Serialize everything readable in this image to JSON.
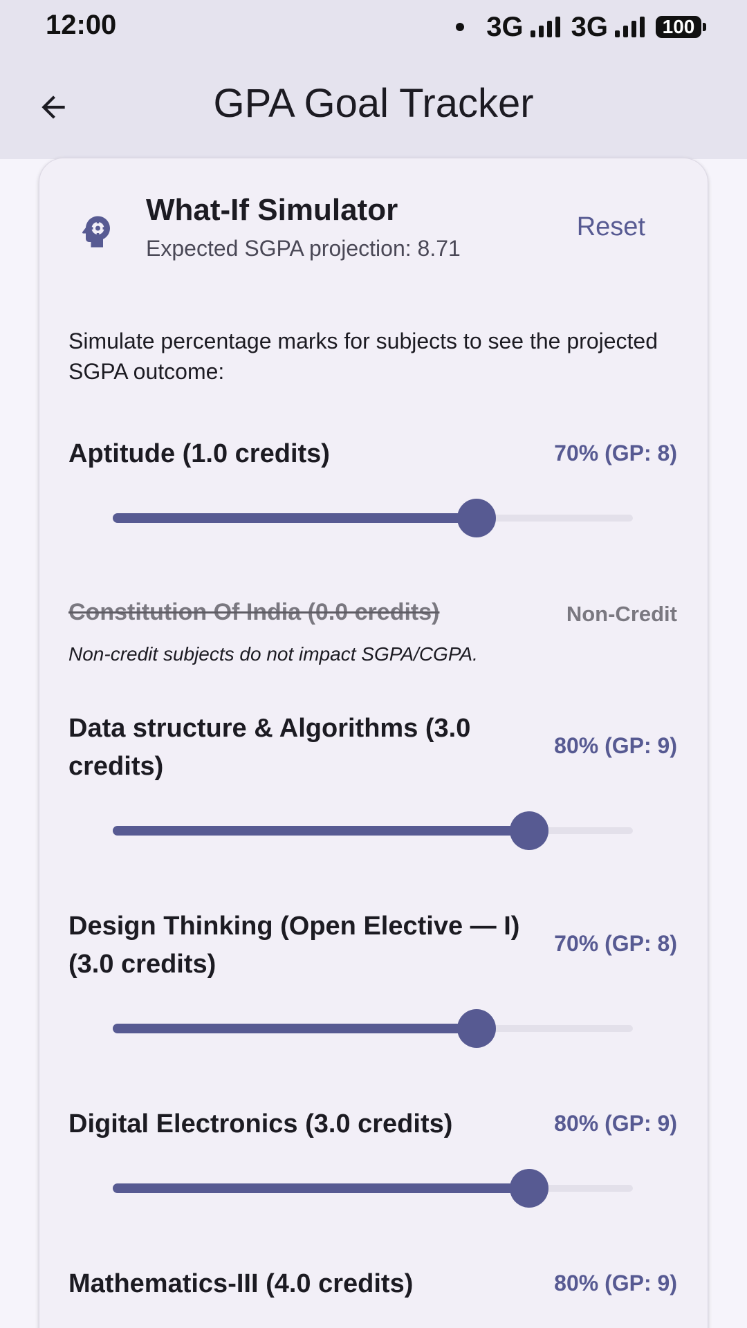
{
  "status_bar": {
    "time": "12:00",
    "network_1": "3G",
    "network_2": "3G",
    "battery": "100"
  },
  "app_bar": {
    "back_icon": "arrow-left-icon",
    "title": "GPA Goal Tracker"
  },
  "simulator": {
    "icon": "head-gear-icon",
    "title": "What-If Simulator",
    "subtitle": "Expected SGPA projection: 8.71",
    "reset_label": "Reset",
    "intro": "Simulate percentage marks for subjects to see the projected SGPA outcome:",
    "subjects": [
      {
        "name": "Aptitude (1.0 credits)",
        "value_label": "70% (GP: 8)",
        "percent": 70
      },
      {
        "name": "Constitution Of India (0.0 credits)",
        "badge": "Non-Credit",
        "note": "Non-credit subjects do not impact SGPA/CGPA."
      },
      {
        "name": "Data structure & Algorithms (3.0 credits)",
        "value_label": "80% (GP: 9)",
        "percent": 80
      },
      {
        "name": "Design Thinking (Open Elective — I) (3.0 credits)",
        "value_label": "70% (GP: 8)",
        "percent": 70
      },
      {
        "name": "Digital Electronics (3.0 credits)",
        "value_label": "80% (GP: 9)",
        "percent": 80
      },
      {
        "name": "Mathematics-III (4.0 credits)",
        "value_label": "80% (GP: 9)",
        "percent": 80
      }
    ]
  },
  "colors": {
    "accent": "#575a92",
    "app_bar": "#e5e3ee",
    "card": "#f2eff7",
    "track": "#e3e0ea",
    "muted": "#7a7880"
  }
}
